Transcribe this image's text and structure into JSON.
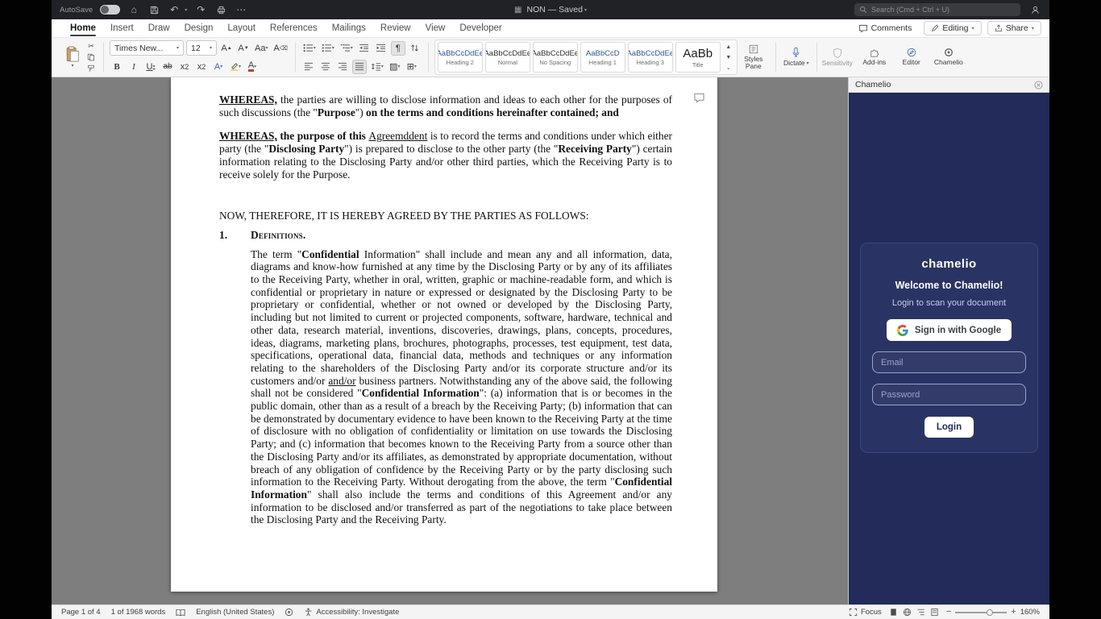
{
  "titlebar": {
    "autosave_label": "AutoSave",
    "doc_title": "NON — Saved",
    "search_placeholder": "Search (Cmd + Ctrl + U)"
  },
  "tabs": {
    "items": [
      "Home",
      "Insert",
      "Draw",
      "Design",
      "Layout",
      "References",
      "Mailings",
      "Review",
      "View",
      "Developer"
    ],
    "comments": "Comments",
    "editing": "Editing",
    "share": "Share"
  },
  "ribbon": {
    "font_name": "Times New...",
    "font_size": "12",
    "styles": [
      {
        "sample": "AaBbCcDdEe",
        "name": "Heading 2"
      },
      {
        "sample": "AaBbCcDdEe",
        "name": "Normal"
      },
      {
        "sample": "AaBbCcDdEe",
        "name": "No Spacing"
      },
      {
        "sample": "AaBbCcD",
        "name": "Heading 1"
      },
      {
        "sample": "AaBbCcDdEe",
        "name": "Heading 3"
      },
      {
        "sample": "AaBb",
        "name": "Title"
      }
    ],
    "styles_pane_label": "Styles Pane",
    "dictate_label": "Dictate",
    "sensitivity_label": "Sensitivity",
    "addins_label": "Add-ins",
    "editor_label": "Editor",
    "chamelio_label": "Chamelio"
  },
  "document": {
    "para_whereas1": [
      {
        "text": "WHEREAS,",
        "bold": true,
        "underline": true
      },
      {
        "text": " the parties are willing to disclose information and ideas to each other for the purposes of such discussions (the \""
      },
      {
        "text": "Purpose",
        "bold": true
      },
      {
        "text": "\") "
      },
      {
        "text": "on the terms and conditions hereinafter contained; and",
        "bold": true
      }
    ],
    "para_whereas2": [
      {
        "text": " "
      },
      {
        "text": "WHEREAS,",
        "bold": true,
        "underline": true
      },
      {
        "text": " the purpose of this ",
        "bold": true
      },
      {
        "text": "Agreemddent",
        "underline": true
      },
      {
        "text": " is to record the terms and conditions under which either party (the \""
      },
      {
        "text": "Disclosing Party",
        "bold": true
      },
      {
        "text": "\") is prepared to disclose to the other party (the \""
      },
      {
        "text": "Receiving Party",
        "bold": true
      },
      {
        "text": "\") certain information relating to the Disclosing Party and/or other third parties, which the Receiving Party is to receive solely for the Purpose."
      }
    ],
    "para_now": [
      {
        "text": "NOW, THEREFORE, IT IS HEREBY AGREED BY THE PARTIES AS FOLLOWS:"
      }
    ],
    "heading_number": "1.",
    "heading_definitions": [
      {
        "text": "Definitions.",
        "bold": true,
        "smallcaps": true
      }
    ],
    "para_definitions": [
      {
        "text": "The term \""
      },
      {
        "text": "Confidential",
        "bold": true
      },
      {
        "text": " Information\" shall include and mean any and all information, data, diagrams and know-how furnished at any time by the Disclosing Party or by any of its affiliates to the Receiving Party, whether in oral, written, graphic or machine-readable form, and which is confidential or proprietary in nature or expressed or designated by the Disclosing Party to be proprietary or confidential, whether or not owned or developed by the Disclosing Party, including but not limited to current or projected components, software, hardware, technical and other data, research material, inventions, discoveries, drawings, plans, concepts, procedures, ideas, diagrams, marketing plans, brochures, photographs, processes, test equipment, test data, specifications, operational data, financial data, methods and techniques or any information relating to the shareholders of the Disclosing Party and/or its corporate structure and/or its customers and/or "
      },
      {
        "text": "and/or",
        "underline": true
      },
      {
        "text": " business partners. Notwithstanding any of the above said, the following shall not be considered \""
      },
      {
        "text": "Confidential Information",
        "bold": true
      },
      {
        "text": "\": (a) information that is or becomes in the public domain, other than as a result of a breach by the Receiving Party; (b) information that can be demonstrated by documentary evidence to have been known to the Receiving Party at the time of disclosure with no obligation of confidentiality or limitation on use towards the Disclosing Party; and (c) information that becomes known to the Receiving Party from a source other than the Disclosing Party and/or its affiliates, as demonstrated by appropriate documentation, without breach of any obligation of confidence by the Receiving Party or by the party disclosing such information to the Receiving Party. Without derogating from the above, the term \""
      },
      {
        "text": "Confidential Information",
        "bold": true
      },
      {
        "text": "\" shall also include the terms and conditions of this Agreement and/or any information to be disclosed and/or transferred as part of the negotiations to take place between the Disclosing Party and the Receiving Party."
      }
    ]
  },
  "panel": {
    "header_title": "Chamelio",
    "logo": "chamelio",
    "welcome": "Welcome to Chamelio!",
    "subtitle": "Login to scan your document",
    "google_button": "Sign in with Google",
    "email_placeholder": "Email",
    "password_placeholder": "Password",
    "login_button": "Login"
  },
  "statusbar": {
    "page": "Page 1 of 4",
    "words": "1 of 1968 words",
    "language": "English (United States)",
    "accessibility": "Accessibility: Investigate",
    "focus": "Focus",
    "zoom": "160%"
  },
  "colors": {
    "panel_navy": "#222b59",
    "titlebar_dark": "#212225",
    "doc_background_gray": "#7e7e7e"
  }
}
